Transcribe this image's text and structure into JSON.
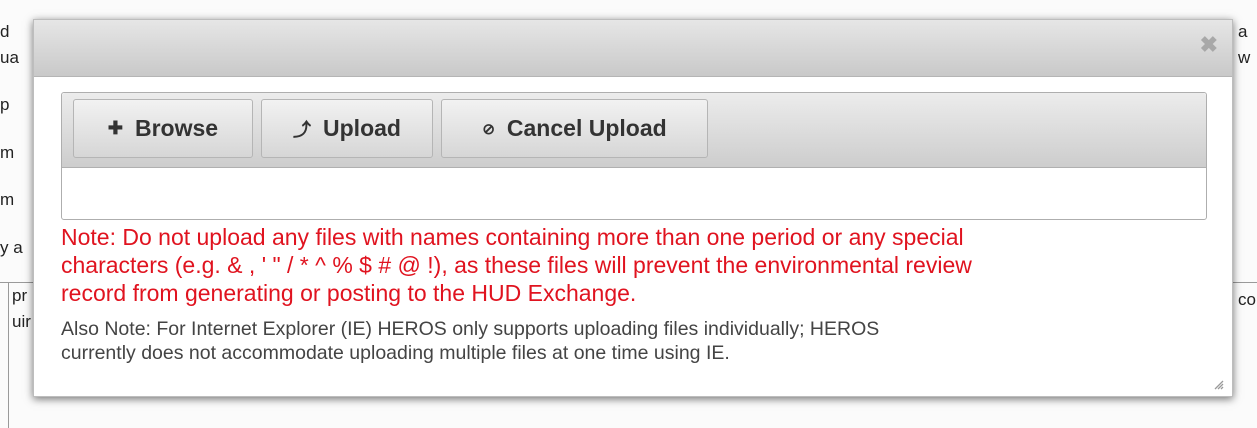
{
  "dialog": {
    "close_symbol": "✖"
  },
  "toolbar": {
    "browse_label": "Browse",
    "upload_label": "Upload",
    "cancel_label": "Cancel Upload",
    "icons": {
      "browse": "plus-icon",
      "upload": "upload-arrow-icon",
      "cancel": "cancel-circle-icon"
    }
  },
  "notes": {
    "warning_line1": "Note: Do not upload any files with names containing more than one period or any special",
    "warning_line2": "characters (e.g. & , ' \" / * ^ % $ # @ !), as these files will prevent the environmental review",
    "warning_line3": "record from generating or posting to the HUD Exchange.",
    "info_line1": "Also Note: For Internet Explorer (IE) HEROS only supports uploading files individually; HEROS",
    "info_line2": "currently does not accommodate uploading multiple files at one time using IE."
  },
  "background_fragments": {
    "left_a": "d",
    "left_b": "ua",
    "left_c": "p",
    "left_d": "m",
    "left_e": "m",
    "left_f": "y a",
    "left_g": "pr",
    "left_h": "uir",
    "right_a": "a",
    "right_b": "w",
    "right_c": "co"
  },
  "colors": {
    "warning": "#e0131f",
    "info": "#444444",
    "toolbar_gradient_top": "#ececec",
    "toolbar_gradient_bottom": "#cdcdcd"
  }
}
